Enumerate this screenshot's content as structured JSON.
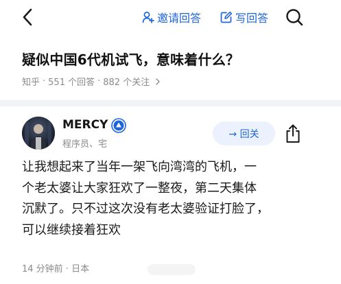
{
  "nav": {
    "invite_label": "邀请回答",
    "write_label": "写回答"
  },
  "question": {
    "title": "疑似中国6代机试飞，意味着什么？",
    "source": "知乎",
    "answers_count": "551 个回答",
    "followers_count": "882 个关注"
  },
  "author": {
    "name": "MERCY",
    "bio": "程序员、宅",
    "follow_label": "→ 回关"
  },
  "answer": {
    "lines": [
      "让我想起来了当年一架飞向湾湾的飞机，一",
      "个老太婆让大家狂欢了一整夜，第二天集体",
      "沉默了。只不过这次没有老太婆验证打脸了，",
      "可以继续接着狂欢"
    ],
    "time": "14 分钟前 · 日本"
  },
  "colors": {
    "accent": "#1e64dc",
    "follow_bg": "#ebf2fe",
    "muted": "#8a8a8a",
    "divider": "#f2f3f5"
  },
  "icons": [
    "back-arrow-icon",
    "person-plus-icon",
    "edit-icon",
    "search-icon",
    "verified-badge-icon",
    "share-icon"
  ]
}
